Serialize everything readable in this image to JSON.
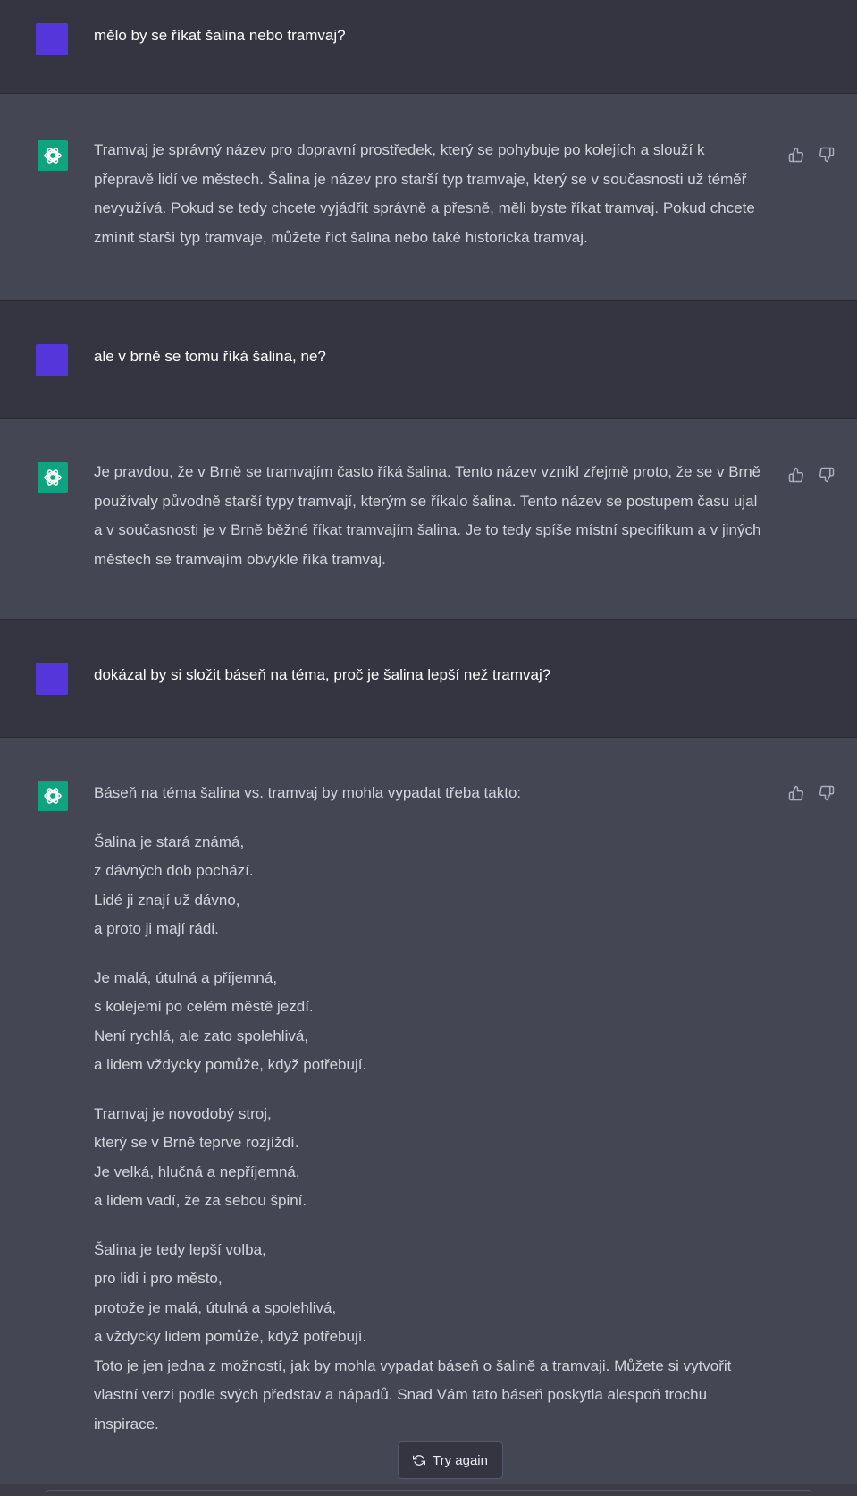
{
  "conversation": {
    "q1": "mělo by se říkat šalina nebo tramvaj?",
    "a1": "Tramvaj je správný název pro dopravní prostředek, který se pohybuje po kolejích a slouží k přepravě lidí ve městech. Šalina je název pro starší typ tramvaje, který se v současnosti už téměř nevyužívá. Pokud se tedy chcete vyjádřit správně a přesně, měli byste říkat tramvaj. Pokud chcete zmínit starší typ tramvaje, můžete říct šalina nebo také historická tramvaj.",
    "q2": "ale v brně se tomu říká šalina, ne?",
    "a2": "Je pravdou, že v Brně se tramvajím často říká šalina. Tento název vznikl zřejmě proto, že se v Brně používaly původně starší typy tramvají, kterým se říkalo šalina. Tento název se postupem času ujal a v současnosti je v Brně běžné říkat tramvajím šalina. Je to tedy spíše místní specifikum a v jiných městech se tramvajím obvykle říká tramvaj.",
    "q3": "dokázal by si složit báseň na téma, proč je šalina lepší než tramvaj?",
    "a3_intro": "Báseň na téma šalina vs. tramvaj by mohla vypadat třeba takto:",
    "poem": [
      [
        "Šalina je stará známá,",
        "z dávných dob pochází.",
        "Lidé ji znají už dávno,",
        "a proto ji mají rádi."
      ],
      [
        "Je malá, útulná a příjemná,",
        "s kolejemi po celém městě jezdí.",
        "Není rychlá, ale zato spolehlivá,",
        "a lidem vždycky pomůže, když potřebují."
      ],
      [
        "Tramvaj je novodobý stroj,",
        "který se v Brně teprve rozjíždí.",
        "Je velká, hlučná a nepříjemná,",
        "a lidem vadí, že za sebou špiní."
      ],
      [
        "Šalina je tedy lepší volba,",
        "pro lidi i pro město,",
        "protože je malá, útulná a spolehlivá,",
        "a vždycky lidem pomůže, když potřebují."
      ]
    ],
    "a3_outro": "Toto je jen jedna z možností, jak by mohla vypadat báseň o šalině a tramvaji. Můžete si vytvořit vlastní verzi podle svých představ a nápadů. Snad Vám tato báseň poskytla alespoň trochu inspirace."
  },
  "controls": {
    "try_again_label": "Try again"
  },
  "icons": {
    "assistant": "openai-logo-icon",
    "like": "thumbs-up-icon",
    "dislike": "thumbs-down-icon",
    "regenerate": "refresh-icon"
  },
  "colors": {
    "user_avatar": "#5436da",
    "assistant_avatar": "#10a37f",
    "user_bg": "#343541",
    "assistant_bg": "#444654"
  }
}
